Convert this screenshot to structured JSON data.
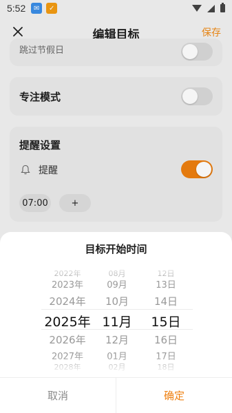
{
  "status_bar": {
    "time": "5:52"
  },
  "header": {
    "title": "编辑目标",
    "save_label": "保存"
  },
  "cards": {
    "partial_text": "跳过节假日",
    "focus_label": "专注模式",
    "reminder_title": "提醒设置",
    "reminder_label": "提醒",
    "reminder_time": "07:00",
    "add_time_label": "+"
  },
  "toggles": {
    "partial": false,
    "focus": false,
    "reminder": true
  },
  "sheet": {
    "title": "目标开始时间",
    "years": [
      "2022年",
      "2023年",
      "2024年",
      "2025年",
      "2026年",
      "2027年",
      "2028年"
    ],
    "months": [
      "08月",
      "09月",
      "10月",
      "11月",
      "12月",
      "01月",
      "02月"
    ],
    "days": [
      "12日",
      "13日",
      "14日",
      "15日",
      "16日",
      "17日",
      "18日"
    ],
    "selected": {
      "year": "2025年",
      "month": "11月",
      "day": "15日"
    },
    "cancel_label": "取消",
    "confirm_label": "确定"
  },
  "colors": {
    "accent": "#ee7f0f",
    "sheet_bg": "#ffffff",
    "card_bg": "#ebebeb"
  },
  "icons": {
    "close": "close-icon",
    "bell": "bell-icon"
  }
}
